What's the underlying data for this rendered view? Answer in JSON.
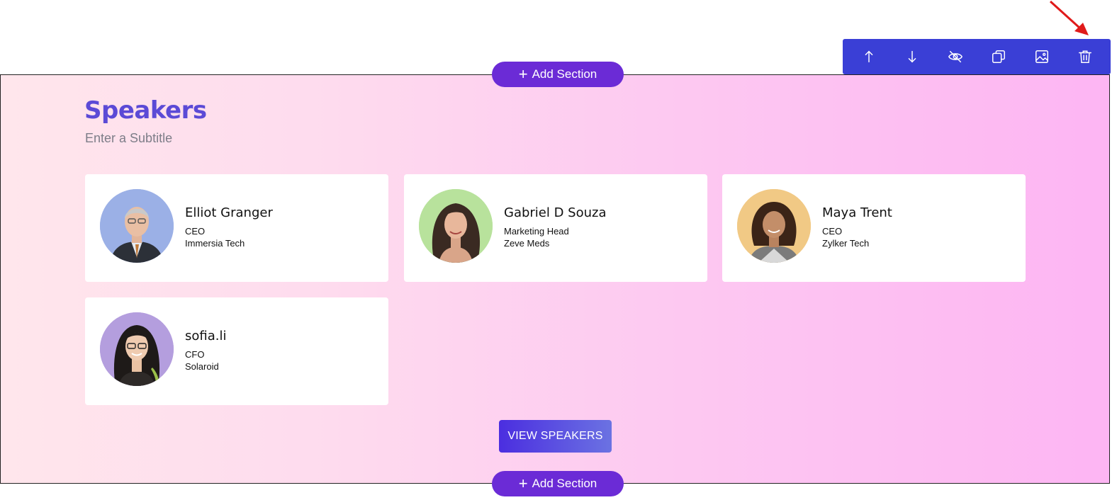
{
  "toolbar": {
    "items": [
      {
        "icon": "arrow-up-icon",
        "label": "Move up"
      },
      {
        "icon": "arrow-down-icon",
        "label": "Move down"
      },
      {
        "icon": "eye-off-icon",
        "label": "Hide"
      },
      {
        "icon": "copy-icon",
        "label": "Duplicate"
      },
      {
        "icon": "image-icon",
        "label": "Background image"
      },
      {
        "icon": "trash-icon",
        "label": "Delete"
      }
    ],
    "color": "#3a3fd6"
  },
  "add_section": {
    "top_label": "Add Section",
    "bottom_label": "Add Section",
    "color": "#6b2bd6"
  },
  "section": {
    "title": "Speakers",
    "subtitle": "Enter a Subtitle",
    "title_color": "#5b4ad6"
  },
  "speakers": [
    {
      "name": "Elliot Granger",
      "role": "CEO",
      "company": "Immersia Tech",
      "avatar_bg": "#9bb0e6"
    },
    {
      "name": "Gabriel D Souza",
      "role": "Marketing Head",
      "company": "Zeve Meds",
      "avatar_bg": "#b8e29c"
    },
    {
      "name": "Maya Trent",
      "role": "CEO",
      "company": "Zylker Tech",
      "avatar_bg": "#f1c985"
    },
    {
      "name": "sofia.li",
      "role": "CFO",
      "company": "Solaroid",
      "avatar_bg": "#b49ede"
    }
  ],
  "view_button": {
    "label": "VIEW SPEAKERS"
  },
  "annotation": {
    "arrow_color": "#e01a1a",
    "target": "trash-icon"
  }
}
